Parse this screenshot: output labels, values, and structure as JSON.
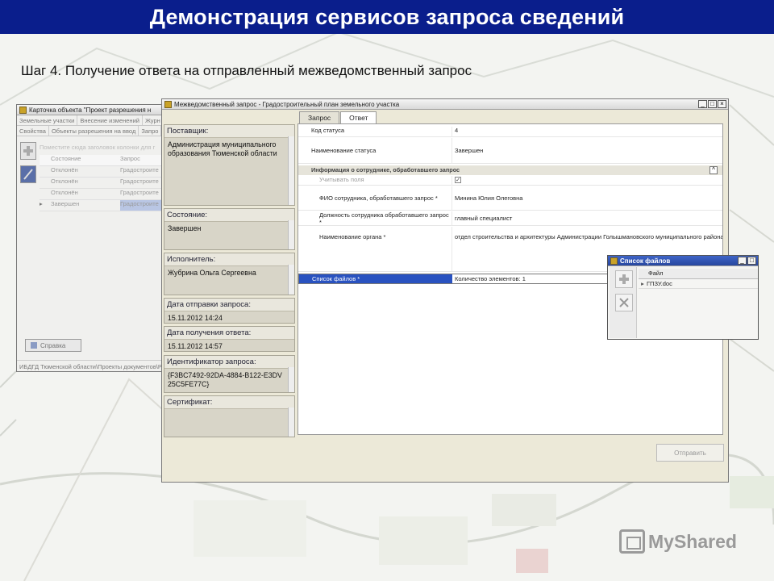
{
  "slide": {
    "title": "Демонстрация сервисов запроса сведений",
    "step": "Шаг 4. Получение ответа на отправленный межведомственный запрос"
  },
  "back_window": {
    "title": "Карточка объекта \"Проект разрешения н",
    "tabs_row1": [
      "Земельные участки",
      "Внесение изменений",
      "Журн"
    ],
    "tabs_row2": [
      "Свойства",
      "Объекты разрешения на ввод",
      "Запро"
    ],
    "toolbar_text": "Поместите сюда заголовок колонки для г",
    "grid_header": [
      "Состояние",
      "Запрос"
    ],
    "grid_rows": [
      [
        "Отклонён",
        "Градостроите"
      ],
      [
        "Отклонён",
        "Градостроите"
      ],
      [
        "Отклонён",
        "Градостроите"
      ],
      [
        "Завершен",
        "Градостроите"
      ]
    ],
    "help_label": "Справка",
    "status_bar": "ИБДГД Тюменской области\\Проекты документов\\Р"
  },
  "main_window": {
    "title": "Межведомственный запрос - Градостроительный план земельного участка",
    "controls": [
      "_",
      "□",
      "×"
    ],
    "tabs": [
      "Запрос",
      "Ответ"
    ],
    "fields": [
      {
        "label": "Поставщик:",
        "value": "Администрация муниципального образования Тюменской области"
      },
      {
        "label": "Состояние:",
        "value": "Завершен"
      },
      {
        "label": "Исполнитель:",
        "value": "Жубрина Ольга Сергеевна"
      },
      {
        "label": "Дата отправки запроса:",
        "value": "15.11.2012 14:24"
      },
      {
        "label": "Дата получения ответа:",
        "value": "15.11.2012 14:57"
      },
      {
        "label": "Идентификатор запроса:",
        "value": "{F3BC7492-92DA-4884-B122-E3DV 25C5FE77C}"
      },
      {
        "label": "Сертификат:",
        "value": ""
      }
    ],
    "response": {
      "status_code_label": "Код статуса",
      "status_code_value": "4",
      "status_name_label": "Наименование статуса",
      "status_name_value": "Завершен",
      "section_title": "Информация о сотруднике, обработавшего запрос",
      "section_toggle": "^",
      "consider_label": "Учитывать поля",
      "consider_check": "✓",
      "fio_label": "ФИО сотрудника, обработавшего запрос *",
      "fio_value": "Минина Юлия Олеговна",
      "position_label": "Должность сотрудника обработавшего запрос *",
      "position_value": "главный специалист",
      "org_label": "Наименование органа *",
      "org_value": "отдел строительства и архитектуры Администрации Голышмановского муниципального района",
      "files_label": "Список файлов *",
      "files_value": "Количество элементов: 1",
      "files_more": "..."
    },
    "send_label": "Отправить"
  },
  "files_window": {
    "title": "Список файлов",
    "controls": [
      "_",
      "□"
    ],
    "column": "Файл",
    "row_pointer": "▸",
    "files": [
      "ГПЗУ.doc"
    ]
  },
  "watermark": {
    "text": "MyShared"
  }
}
